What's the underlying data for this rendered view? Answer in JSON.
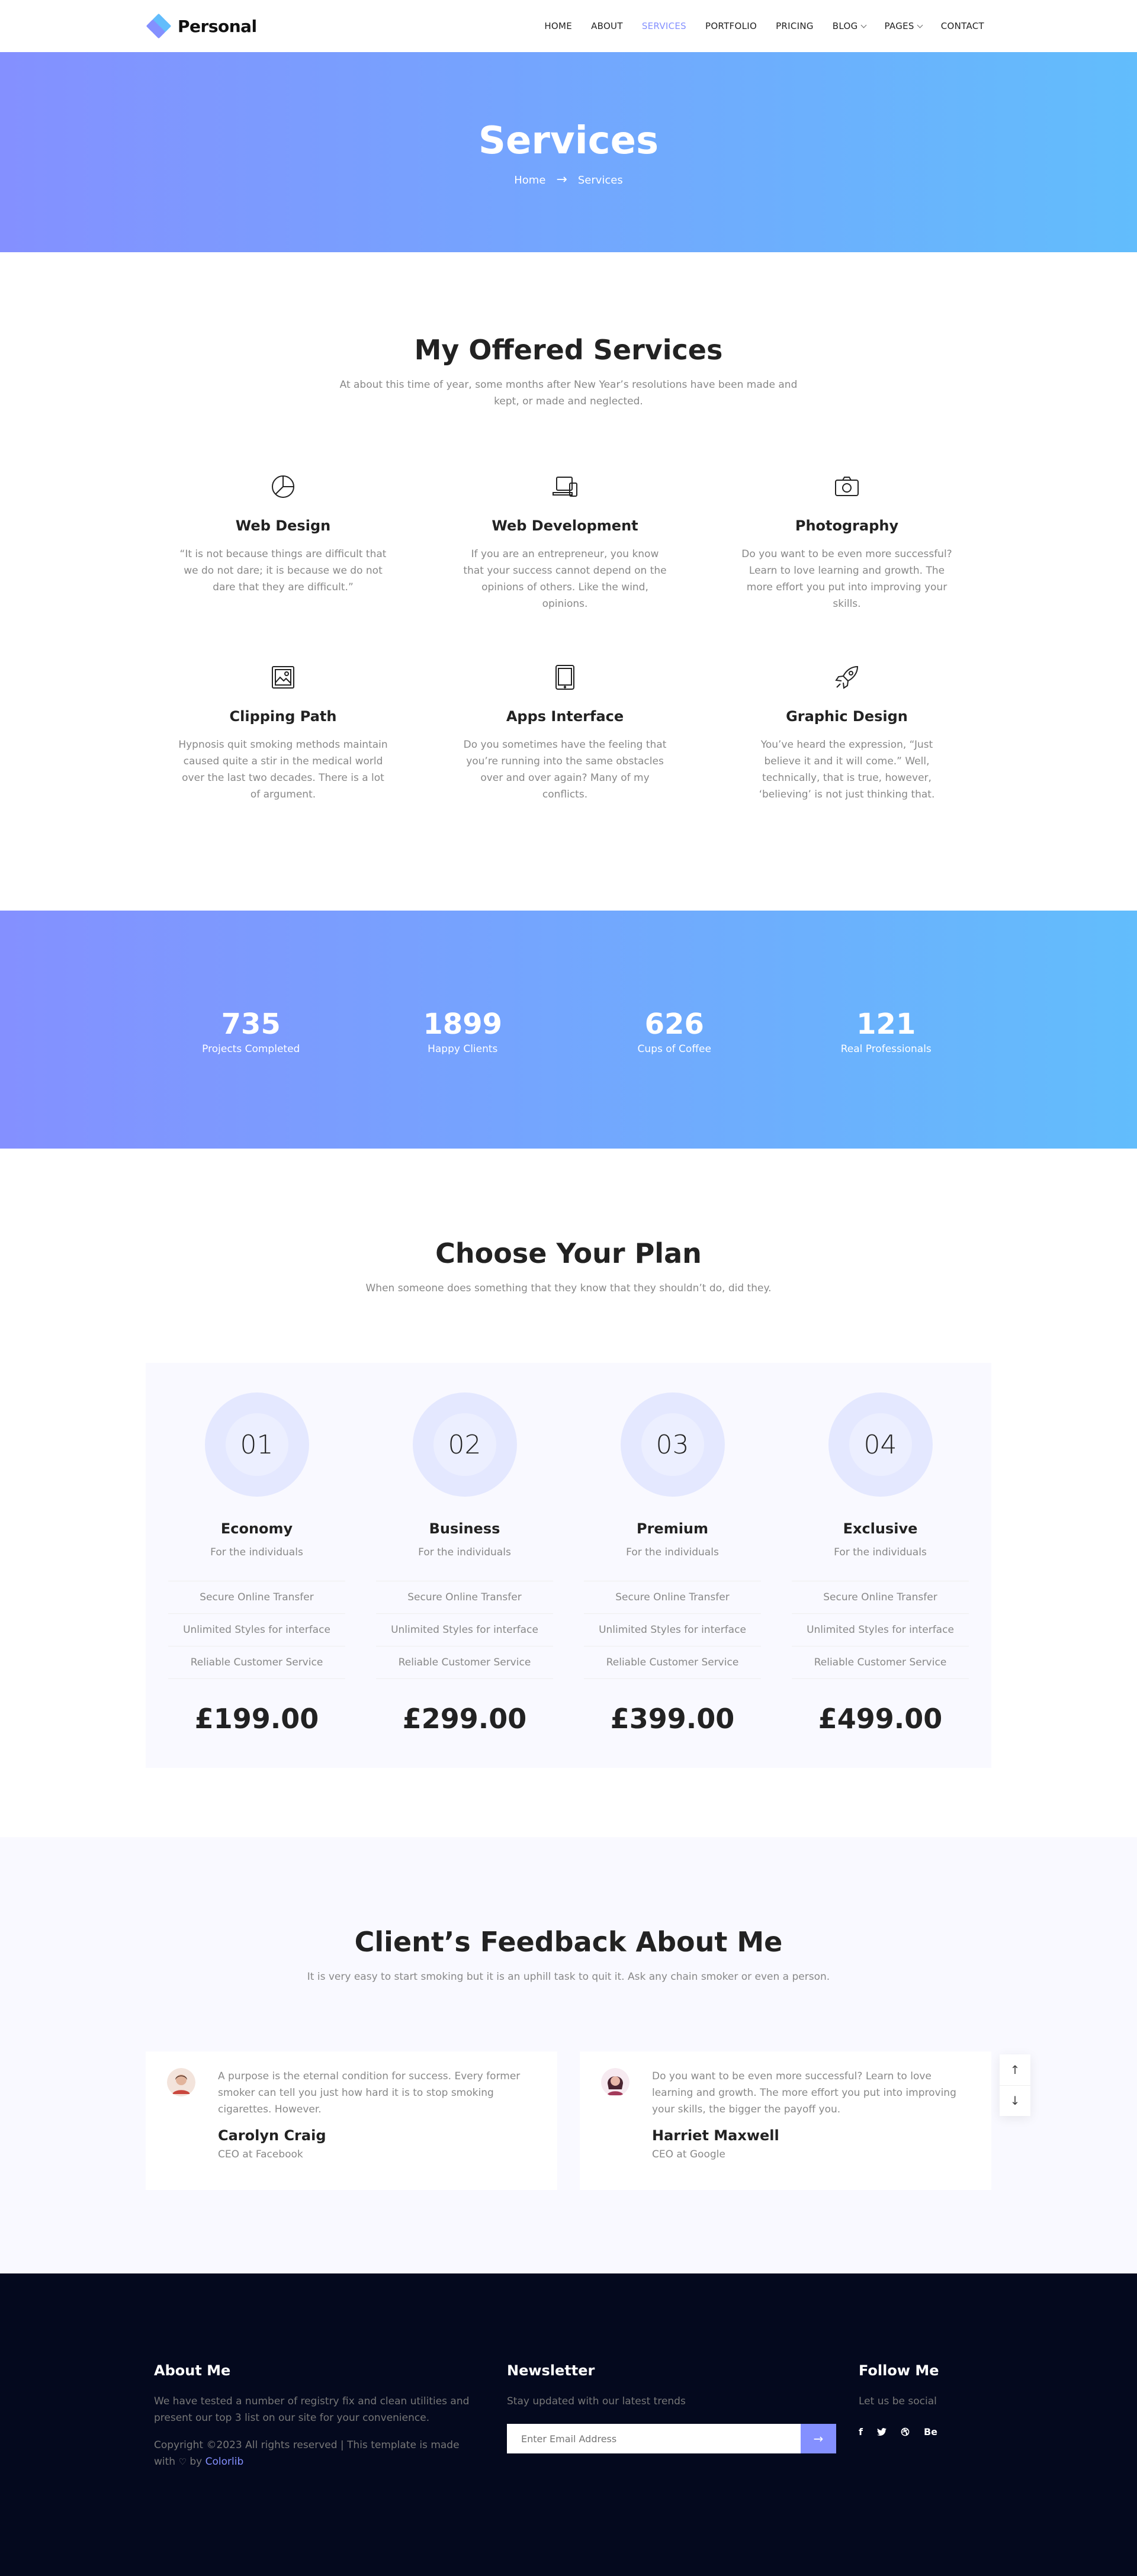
{
  "header": {
    "logo_text": "Personal",
    "nav": [
      {
        "label": "Home",
        "active": false,
        "dropdown": false
      },
      {
        "label": "About",
        "active": false,
        "dropdown": false
      },
      {
        "label": "Services",
        "active": true,
        "dropdown": false
      },
      {
        "label": "Portfolio",
        "active": false,
        "dropdown": false
      },
      {
        "label": "Pricing",
        "active": false,
        "dropdown": false
      },
      {
        "label": "Blog",
        "active": false,
        "dropdown": true
      },
      {
        "label": "Pages",
        "active": false,
        "dropdown": true
      },
      {
        "label": "Contact",
        "active": false,
        "dropdown": false
      }
    ]
  },
  "banner": {
    "title": "Services",
    "breadcrumb": {
      "home": "Home",
      "separator": "→",
      "current": "Services"
    }
  },
  "services": {
    "title": "My Offered Services",
    "subtitle": "At about this time of year, some months after New Year’s resolutions have been made and kept, or made and neglected.",
    "items": [
      {
        "icon": "pie-chart-icon",
        "title": "Web Design",
        "text": "“It is not because things are difficult that we do not dare; it is because we do not dare that they are difficult.”"
      },
      {
        "icon": "devices-icon",
        "title": "Web Development",
        "text": "If you are an entrepreneur, you know that your success cannot depend on the opinions of others. Like the wind, opinions."
      },
      {
        "icon": "camera-icon",
        "title": "Photography",
        "text": "Do you want to be even more successful? Learn to love learning and growth. The more effort you put into improving your skills."
      },
      {
        "icon": "picture-icon",
        "title": "Clipping Path",
        "text": "Hypnosis quit smoking methods maintain caused quite a stir in the medical world over the last two decades. There is a lot of argument."
      },
      {
        "icon": "tablet-icon",
        "title": "Apps Interface",
        "text": "Do you sometimes have the feeling that you’re running into the same obstacles over and over again? Many of my conflicts."
      },
      {
        "icon": "rocket-icon",
        "title": "Graphic Design",
        "text": "You’ve heard the expression, “Just believe it and it will come.” Well, technically, that is true, however, ‘believing’ is not just thinking that."
      }
    ]
  },
  "facts": [
    {
      "number": "735",
      "label": "Projects Completed"
    },
    {
      "number": "1899",
      "label": "Happy Clients"
    },
    {
      "number": "626",
      "label": "Cups of Coffee"
    },
    {
      "number": "121",
      "label": "Real Professionals"
    }
  ],
  "pricing": {
    "title": "Choose Your Plan",
    "subtitle": "When someone does something that they know that they shouldn’t do, did they.",
    "plans": [
      {
        "num": "01",
        "name": "Economy",
        "for": "For the individuals",
        "features": [
          "Secure Online Transfer",
          "Unlimited Styles for interface",
          "Reliable Customer Service"
        ],
        "price": "£199.00"
      },
      {
        "num": "02",
        "name": "Business",
        "for": "For the individuals",
        "features": [
          "Secure Online Transfer",
          "Unlimited Styles for interface",
          "Reliable Customer Service"
        ],
        "price": "£299.00"
      },
      {
        "num": "03",
        "name": "Premium",
        "for": "For the individuals",
        "features": [
          "Secure Online Transfer",
          "Unlimited Styles for interface",
          "Reliable Customer Service"
        ],
        "price": "£399.00"
      },
      {
        "num": "04",
        "name": "Exclusive",
        "for": "For the individuals",
        "features": [
          "Secure Online Transfer",
          "Unlimited Styles for interface",
          "Reliable Customer Service"
        ],
        "price": "£499.00"
      }
    ]
  },
  "feedback": {
    "title": "Client’s Feedback About Me",
    "subtitle": "It is very easy to start smoking but it is an uphill task to quit it. Ask any chain smoker or even a person.",
    "items": [
      {
        "text": "A purpose is the eternal condition for success. Every former smoker can tell you just how hard it is to stop smoking cigarettes. However.",
        "name": "Carolyn Craig",
        "role": "CEO at Facebook"
      },
      {
        "text": "Do you want to be even more successful? Learn to love learning and growth. The more effort you put into improving your skills, the bigger the payoff you.",
        "name": "Harriet Maxwell",
        "role": "CEO at Google"
      }
    ],
    "scroll_up": "↑",
    "scroll_down": "↓"
  },
  "footer": {
    "about": {
      "title": "About Me",
      "text": "We have tested a number of registry fix and clean utilities and present our top 3 list on our site for your convenience.",
      "copyright": "Copyright ©2023 All rights reserved | This template is made with",
      "heart": "♡",
      "by": "by",
      "credit": "Colorlib"
    },
    "newsletter": {
      "title": "Newsletter",
      "text": "Stay updated with our latest trends",
      "placeholder": "Enter Email Address",
      "submit": "→"
    },
    "follow": {
      "title": "Follow Me",
      "text": "Let us be social",
      "socials": [
        "f",
        "t",
        "d",
        "Be"
      ]
    }
  },
  "colors": {
    "accent": "#8490ff",
    "gradient_start": "#8490ff",
    "gradient_end": "#62bdfc",
    "footer_bg": "#04091e"
  }
}
